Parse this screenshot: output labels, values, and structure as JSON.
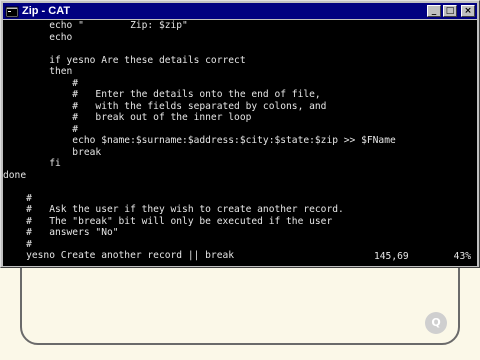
{
  "window": {
    "title": "Zip - CAT",
    "buttons": {
      "minimize": "_",
      "maximize": "□",
      "close": "×"
    }
  },
  "editor": {
    "lines": [
      "        echo \"        Zip: $zip\"",
      "        echo",
      "",
      "        if yesno Are these details correct",
      "        then",
      "            #",
      "            #   Enter the details onto the end of file,",
      "            #   with the fields separated by colons, and",
      "            #   break out of the inner loop",
      "            #",
      "            echo $name:$surname:$address:$city:$state:$zip >> $FName",
      "            break",
      "        fi",
      "done",
      "",
      "    #",
      "    #   Ask the user if they wish to create another record.",
      "    #   The \"break\" bit will only be executed if the user",
      "    #   answers \"No\"",
      "    #",
      "    yesno Create another record || break"
    ]
  },
  "status": {
    "position": "145,69",
    "percent": "43%"
  },
  "background": {
    "watermark": "Q"
  }
}
